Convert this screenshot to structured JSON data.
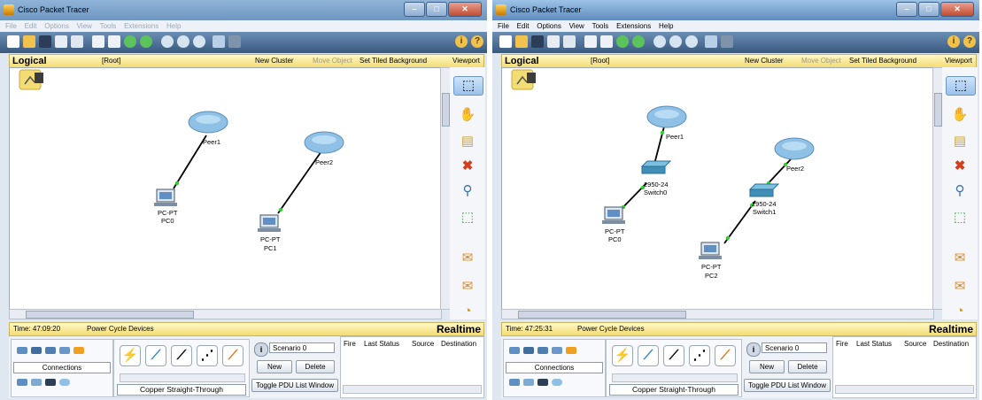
{
  "windows": [
    {
      "title": "Cisco Packet Tracer",
      "menu": [
        "File",
        "Edit",
        "Options",
        "View",
        "Tools",
        "Extensions",
        "Help"
      ],
      "nav": {
        "view": "Logical",
        "root": "[Root]",
        "new_cluster": "New Cluster",
        "move_object": "Move Object",
        "set_tiled_bg": "Set Tiled Background",
        "viewport": "Viewport"
      },
      "status": {
        "time": "Time: 47:09:20",
        "power": "Power Cycle Devices",
        "mode": "Realtime"
      },
      "connections_label": "Connections",
      "cable_label": "Copper Straight-Through",
      "scenario": {
        "selected": "Scenario 0",
        "new": "New",
        "delete": "Delete",
        "toggle": "Toggle PDU List Window"
      },
      "pdu_headers": [
        "Fire",
        "Last Status",
        "Source",
        "Destination"
      ],
      "devices": {
        "peer1": "Peer1",
        "peer2": "Peer2",
        "pc0_type": "PC-PT",
        "pc0_name": "PC0",
        "pc1_type": "PC-PT",
        "pc1_name": "PC1"
      }
    },
    {
      "title": "Cisco Packet Tracer",
      "menu": [
        "File",
        "Edit",
        "Options",
        "View",
        "Tools",
        "Extensions",
        "Help"
      ],
      "nav": {
        "view": "Logical",
        "root": "[Root]",
        "new_cluster": "New Cluster",
        "move_object": "Move Object",
        "set_tiled_bg": "Set Tiled Background",
        "viewport": "Viewport"
      },
      "status": {
        "time": "Time: 47:25:31",
        "power": "Power Cycle Devices",
        "mode": "Realtime"
      },
      "connections_label": "Connections",
      "cable_label": "Copper Straight-Through",
      "scenario": {
        "selected": "Scenario 0",
        "new": "New",
        "delete": "Delete",
        "toggle": "Toggle PDU List Window"
      },
      "pdu_headers": [
        "Fire",
        "Last Status",
        "Source",
        "Destination"
      ],
      "devices": {
        "peer1": "Peer1",
        "peer2": "Peer2",
        "sw0_model": "2950-24",
        "sw0_name": "Switch0",
        "sw1_model": "2950-24",
        "sw1_name": "Switch1",
        "pc0_type": "PC-PT",
        "pc0_name": "PC0",
        "pc2_type": "PC-PT",
        "pc2_name": "PC2"
      }
    }
  ],
  "colors": {
    "link": "#000000",
    "link_led": "#2fd12f",
    "cloud": "#8fc0e6",
    "switch": "#3f8fb8"
  }
}
